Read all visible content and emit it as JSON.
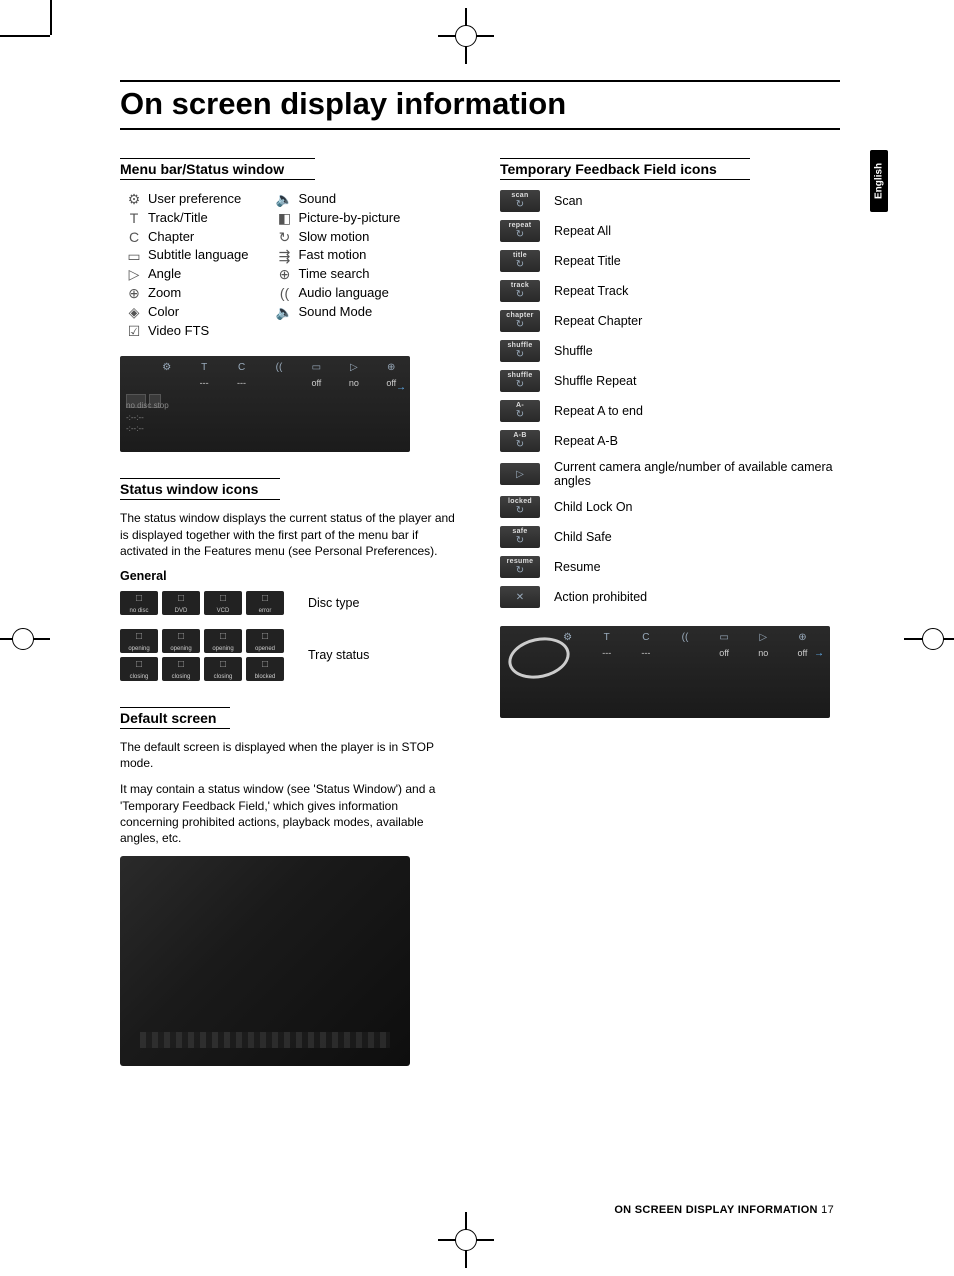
{
  "title": "On screen display information",
  "lang_tab": "English",
  "footer_label": "ON SCREEN DISPLAY INFORMATION",
  "footer_page": "17",
  "left": {
    "heading_menu": "Menu bar/Status window",
    "menu_left": [
      "User preference",
      "Track/Title",
      "Chapter",
      "Subtitle language",
      "Angle",
      "Zoom",
      "Color",
      "Video FTS"
    ],
    "menu_right": [
      "Sound",
      "Picture-by-picture",
      "Slow motion",
      "Fast motion",
      "Time search",
      "Audio language",
      "Sound Mode"
    ],
    "osd_head": [
      "⚙",
      "T",
      "C",
      "((",
      "▭",
      "▷",
      "⊕"
    ],
    "osd_vals": [
      "",
      "---",
      "---",
      "",
      "off",
      "no",
      "off"
    ],
    "osd_side": [
      "no disc  stop",
      "-:--:--",
      "-:--:--"
    ],
    "heading_status": "Status window icons",
    "status_para": "The status window displays the current status of the player and is displayed together with the first part of the menu bar if activated in the Features menu (see Personal Preferences).",
    "general": "General",
    "disc_type_label": "Disc type",
    "disc_type_tiles": [
      "no disc",
      "DVD",
      "VCD",
      "error"
    ],
    "tray_status_label": "Tray status",
    "tray_tiles": [
      "opening",
      "opening",
      "opening",
      "opened",
      "closing",
      "closing",
      "closing",
      "blocked"
    ],
    "heading_default": "Default screen",
    "default_p1": "The default screen is displayed when the player is in STOP mode.",
    "default_p2": "It may contain a status window (see 'Status Window') and a 'Temporary Feedback Field,' which gives information concerning prohibited actions, playback modes, available angles, etc."
  },
  "right": {
    "heading": "Temporary Feedback Field icons",
    "items": [
      {
        "badge": "scan",
        "label": "Scan"
      },
      {
        "badge": "repeat",
        "label": "Repeat All"
      },
      {
        "badge": "title",
        "label": "Repeat Title"
      },
      {
        "badge": "track",
        "label": "Repeat Track"
      },
      {
        "badge": "chapter",
        "label": "Repeat Chapter"
      },
      {
        "badge": "shuffle",
        "label": "Shuffle"
      },
      {
        "badge": "shuffle",
        "label": "Shuffle Repeat"
      },
      {
        "badge": "A-",
        "label": "Repeat A to end"
      },
      {
        "badge": "A-B",
        "label": "Repeat A-B"
      },
      {
        "badge": "",
        "label": "Current camera angle/number of available camera angles"
      },
      {
        "badge": "locked",
        "label": "Child Lock On"
      },
      {
        "badge": "safe",
        "label": "Child Safe"
      },
      {
        "badge": "resume",
        "label": "Resume"
      },
      {
        "badge": "",
        "label": "Action prohibited"
      }
    ],
    "osd2_head": [
      "⚙",
      "T",
      "C",
      "((",
      "▭",
      "▷",
      "⊕"
    ],
    "osd2_vals": [
      "",
      "---",
      "---",
      "",
      "off",
      "no",
      "off"
    ]
  }
}
